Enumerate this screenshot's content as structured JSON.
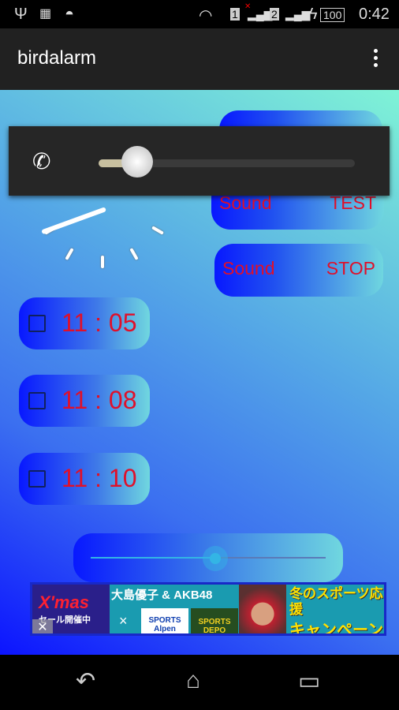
{
  "status_bar": {
    "time": "0:42",
    "battery": "100",
    "sim1": "1",
    "sim2": "2"
  },
  "app_bar": {
    "title": "birdalarm"
  },
  "buttons": [
    {
      "left": "Sound",
      "right": "TEST"
    },
    {
      "left": "Sound",
      "right": "STOP"
    }
  ],
  "alarms": [
    {
      "time": "11 : 05",
      "checked": false
    },
    {
      "time": "11 : 08",
      "checked": false
    },
    {
      "time": "11 : 10",
      "checked": false
    }
  ],
  "seek_bar": {
    "value_fraction": 0.53
  },
  "volume_dialog": {
    "icon": "ringer-volume-icon",
    "value_fraction": 0.15
  },
  "ad": {
    "xmas": "X'mas",
    "sale": "セール開催中",
    "collab": "大島優子 & AKB48",
    "times": "×",
    "alpen": "SPORTS Alpen",
    "depo": "SPORTS DEPO",
    "campaign_1": "冬のスポーツ応援",
    "campaign_2": "キャンペーン",
    "close": "✕"
  },
  "colors": {
    "accent": "#33b5e5",
    "text_red": "#e0102a",
    "appbar": "#212121"
  }
}
